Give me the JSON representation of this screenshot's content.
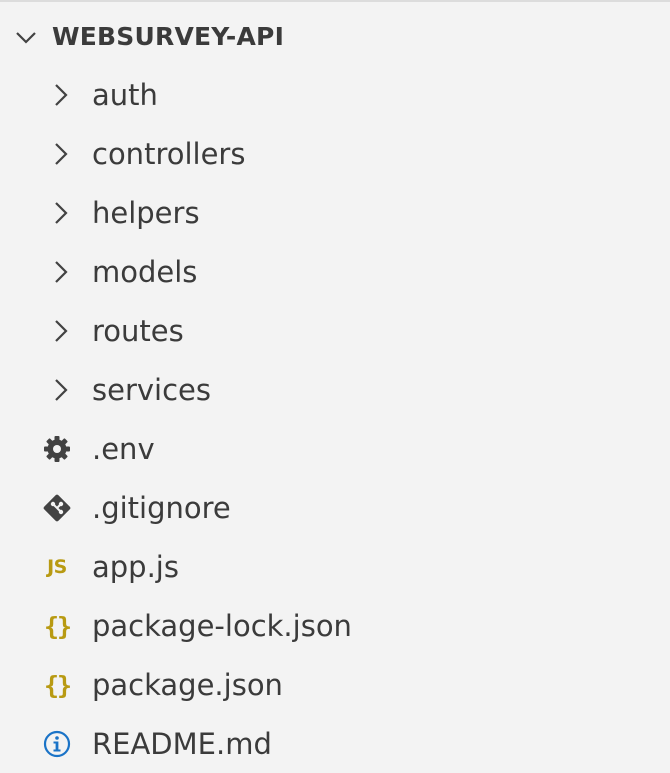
{
  "explorer": {
    "root": {
      "label": "WEBSURVEY-API",
      "icon": "chevron-down-icon",
      "expanded": true
    },
    "folders": [
      {
        "label": "auth",
        "icon": "chevron-right-icon"
      },
      {
        "label": "controllers",
        "icon": "chevron-right-icon"
      },
      {
        "label": "helpers",
        "icon": "chevron-right-icon"
      },
      {
        "label": "models",
        "icon": "chevron-right-icon"
      },
      {
        "label": "routes",
        "icon": "chevron-right-icon"
      },
      {
        "label": "services",
        "icon": "chevron-right-icon"
      }
    ],
    "files": [
      {
        "label": ".env",
        "icon": "gear-icon"
      },
      {
        "label": ".gitignore",
        "icon": "git-icon"
      },
      {
        "label": "app.js",
        "icon": "javascript-icon",
        "badge": "JS"
      },
      {
        "label": "package-lock.json",
        "icon": "json-icon",
        "badge": "{}"
      },
      {
        "label": "package.json",
        "icon": "json-icon",
        "badge": "{}"
      },
      {
        "label": "README.md",
        "icon": "info-icon"
      }
    ],
    "colors": {
      "background": "#f3f3f3",
      "text": "#3b3b3b",
      "icon": "#424242",
      "json_js_accent": "#b89a12",
      "info_accent": "#1a73c7"
    }
  }
}
